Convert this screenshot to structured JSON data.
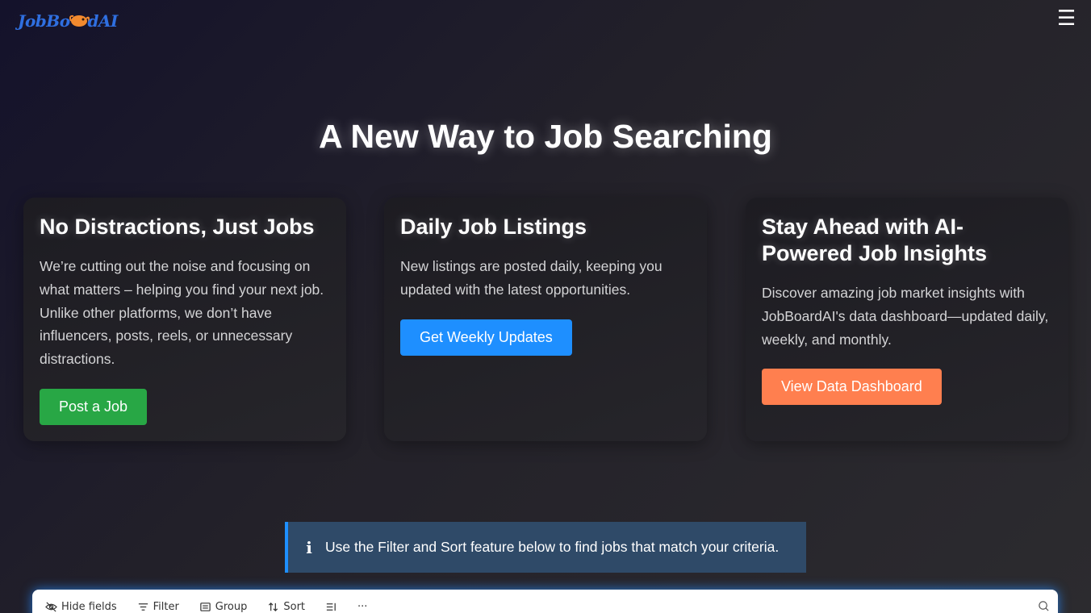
{
  "brand": {
    "logo_text_left": "JobBo",
    "logo_text_right": "dAI"
  },
  "hero": {
    "title": "A New Way to Job Searching"
  },
  "cards": [
    {
      "title": "No Distractions, Just Jobs",
      "body": "We’re cutting out the noise and focusing on what matters – helping you find your next job. Unlike other platforms, we don’t have influencers, posts, reels, or unnecessary distractions.",
      "button": "Post a Job"
    },
    {
      "title": "Daily Job Listings",
      "body": "New listings are posted daily, keeping you updated with the latest opportunities.",
      "button": "Get Weekly Updates"
    },
    {
      "title": "Stay Ahead with AI-Powered Job Insights",
      "body": "Discover amazing job market insights with JobBoardAI's data dashboard—updated daily, weekly, and monthly.",
      "button": "View Data Dashboard"
    }
  ],
  "info": {
    "icon": "info-icon",
    "text": "Use the Filter and Sort feature below to find jobs that match your criteria."
  },
  "toolbar": {
    "hide_fields": "Hide fields",
    "filter": "Filter",
    "group": "Group",
    "sort": "Sort",
    "more": "···"
  },
  "colors": {
    "green": "#28a745",
    "blue": "#1e8fff",
    "orange": "#ff7f4f",
    "logo": "#2f6fe0"
  }
}
